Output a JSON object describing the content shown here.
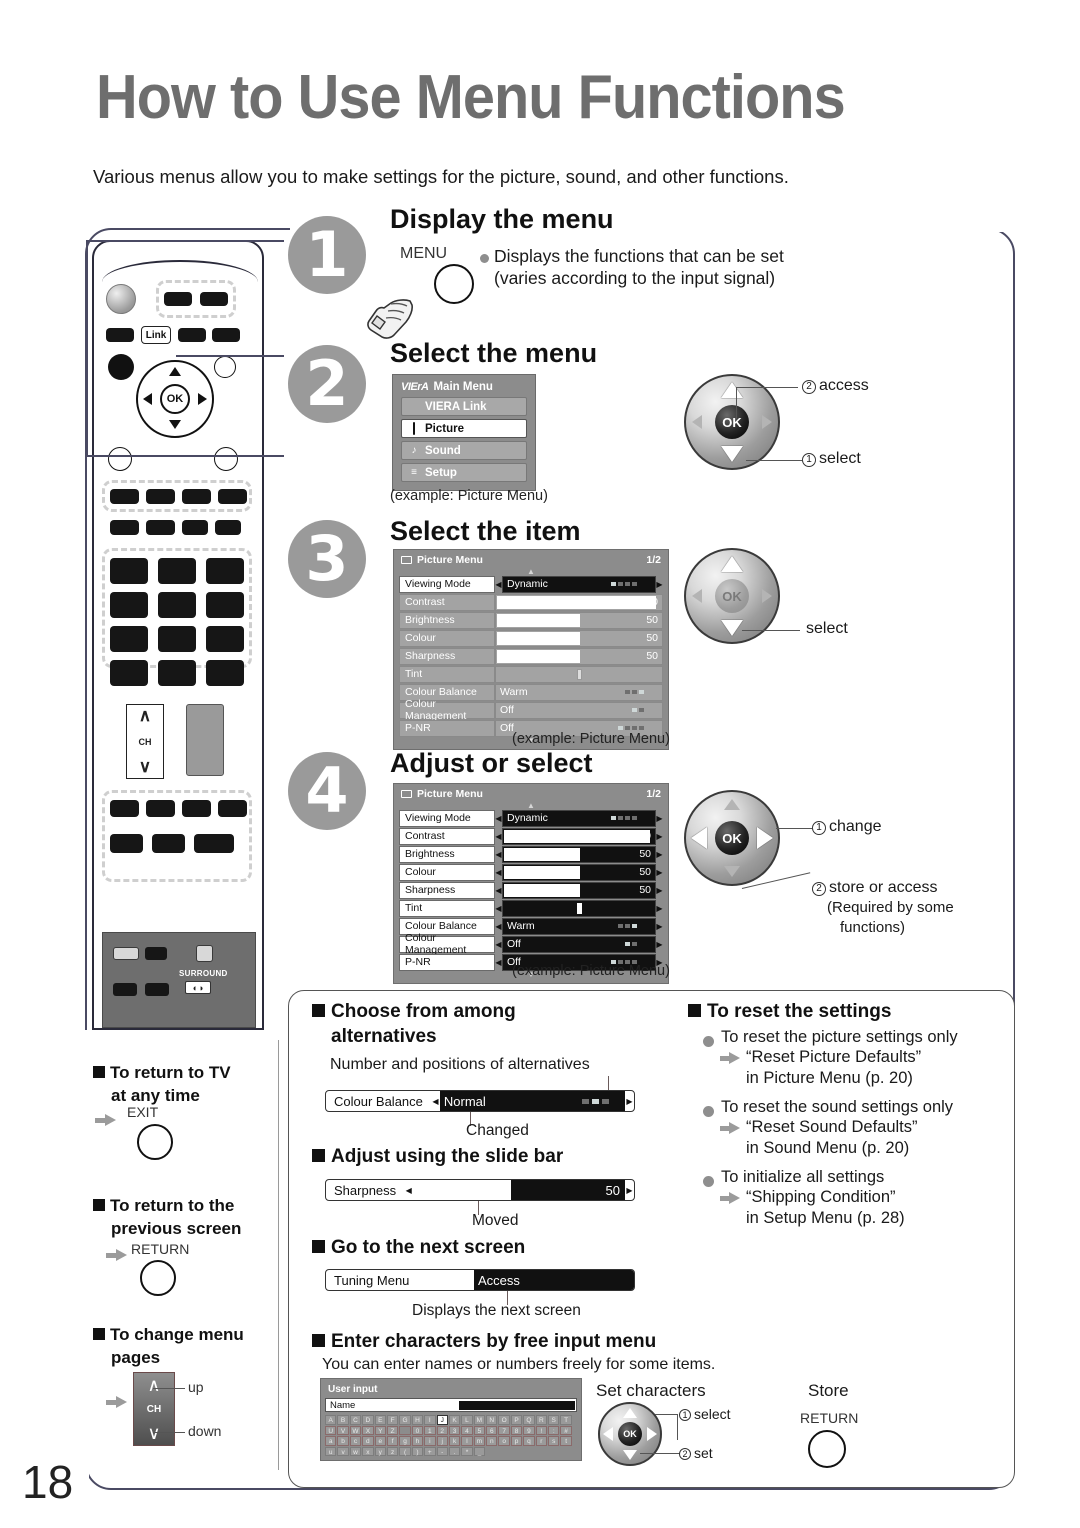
{
  "page": {
    "title": "How to Use Menu Functions",
    "intro": "Various menus allow you to make settings for the picture, sound, and other functions.",
    "number": "18"
  },
  "steps": [
    {
      "num": "1",
      "heading": "Display the menu",
      "key_label": "MENU",
      "desc_line1": "Displays the functions that can be set",
      "desc_line2": "(varies according to the input signal)"
    },
    {
      "num": "2",
      "heading": "Select the menu",
      "caption": "(example: Picture Menu)",
      "wheel_labels": [
        {
          "index": "2",
          "text": "access"
        },
        {
          "index": "1",
          "text": "select"
        }
      ]
    },
    {
      "num": "3",
      "heading": "Select the item",
      "caption": "(example: Picture Menu)",
      "wheel_labels": [
        {
          "index": "",
          "text": "select"
        }
      ]
    },
    {
      "num": "4",
      "heading": "Adjust or select",
      "caption": "(example: Picture Menu)",
      "wheel_labels": [
        {
          "index": "1",
          "text": "change"
        },
        {
          "index": "2",
          "text": "store or access"
        }
      ],
      "wheel_sub_line1": "(Required by some",
      "wheel_sub_line2": "functions)"
    }
  ],
  "main_menu": {
    "logo": "VIErA",
    "title": "Main Menu",
    "items": [
      {
        "label": "VIERA Link",
        "icon": "none",
        "selected": false
      },
      {
        "label": "Picture",
        "icon": "picture-icon",
        "selected": true
      },
      {
        "label": "Sound",
        "icon": "music-note-icon",
        "selected": false
      },
      {
        "label": "Setup",
        "icon": "list-icon",
        "selected": false
      }
    ]
  },
  "picture_menu": {
    "title": "Picture Menu",
    "page_indicator": "1/2",
    "rows": [
      {
        "label": "Viewing Mode",
        "value": "Dynamic",
        "type": "options",
        "dots": 4,
        "dot_on": 0,
        "selected": true
      },
      {
        "label": "Contrast",
        "value": "100",
        "type": "slider",
        "fill": 96,
        "selected": false
      },
      {
        "label": "Brightness",
        "value": "50",
        "type": "slider",
        "fill": 50,
        "selected": false
      },
      {
        "label": "Colour",
        "value": "50",
        "type": "slider",
        "fill": 50,
        "selected": false
      },
      {
        "label": "Sharpness",
        "value": "50",
        "type": "slider",
        "fill": 50,
        "selected": false
      },
      {
        "label": "Tint",
        "value": "",
        "type": "knob",
        "fill": 50,
        "selected": false
      },
      {
        "label": "Colour Balance",
        "value": "Warm",
        "type": "options",
        "dots": 3,
        "dot_on": 2,
        "selected": false
      },
      {
        "label": "Colour Management",
        "value": "Off",
        "type": "options",
        "dots": 2,
        "dot_on": 0,
        "selected": false
      },
      {
        "label": "P-NR",
        "value": "Off",
        "type": "options",
        "dots": 4,
        "dot_on": 0,
        "selected": false
      }
    ]
  },
  "picture_menu_active": {
    "title": "Picture Menu",
    "page_indicator": "1/2",
    "rows": [
      {
        "label": "Viewing Mode",
        "value": "Dynamic",
        "type": "options",
        "dots": 4,
        "dot_on": 0,
        "selected": true
      },
      {
        "label": "Contrast",
        "value": "100",
        "type": "slider",
        "fill": 96,
        "selected": true
      },
      {
        "label": "Brightness",
        "value": "50",
        "type": "slider",
        "fill": 50,
        "selected": true
      },
      {
        "label": "Colour",
        "value": "50",
        "type": "slider",
        "fill": 50,
        "selected": true
      },
      {
        "label": "Sharpness",
        "value": "50",
        "type": "slider",
        "fill": 50,
        "selected": true
      },
      {
        "label": "Tint",
        "value": "",
        "type": "knob",
        "fill": 50,
        "selected": true
      },
      {
        "label": "Colour Balance",
        "value": "Warm",
        "type": "options",
        "dots": 3,
        "dot_on": 2,
        "selected": true
      },
      {
        "label": "Colour Management",
        "value": "Off",
        "type": "options",
        "dots": 2,
        "dot_on": 0,
        "selected": true
      },
      {
        "label": "P-NR",
        "value": "Off",
        "type": "options",
        "dots": 4,
        "dot_on": 0,
        "selected": true
      }
    ]
  },
  "left_notes": [
    {
      "heading_line1": "To return to TV",
      "heading_line2": "at any time",
      "key_label": "EXIT"
    },
    {
      "heading_line1": "To return to the",
      "heading_line2": "previous screen",
      "key_label": "RETURN"
    },
    {
      "heading_line1": "To change menu",
      "heading_line2": "pages",
      "key_label": "CH",
      "up_label": "up",
      "down_label": "down"
    }
  ],
  "bottom": {
    "choose": {
      "heading_line1": "Choose from among",
      "heading_line2": "alternatives",
      "note_top": "Number and positions of alternatives",
      "note_bottom": "Changed",
      "row": {
        "label": "Colour Balance",
        "value": "Normal",
        "dots": 3,
        "dot_on": 1
      }
    },
    "slide": {
      "heading": "Adjust using the slide bar",
      "note_bottom": "Moved",
      "row": {
        "label": "Sharpness",
        "value": "50",
        "fill": 46
      }
    },
    "next_screen": {
      "heading": "Go to the next screen",
      "note_bottom": "Displays the next screen",
      "row": {
        "label": "Tuning Menu",
        "value": "Access"
      }
    },
    "free_input": {
      "heading": "Enter characters by free input menu",
      "sub": "You can enter names or numbers freely for some items.",
      "set_characters_label": "Set characters",
      "store_label": "Store",
      "store_key": "RETURN",
      "wheel_labels": [
        {
          "index": "1",
          "text": "select"
        },
        {
          "index": "2",
          "text": "set"
        }
      ],
      "panel": {
        "title": "User input",
        "name_label": "Name",
        "keyboard_rows": [
          [
            "A",
            "B",
            "C",
            "D",
            "E",
            "F",
            "G",
            "H",
            "I",
            "J",
            "K",
            "L",
            "M",
            "N",
            "O",
            "P",
            "Q",
            "R",
            "S",
            "T"
          ],
          [
            "U",
            "V",
            "W",
            "X",
            "Y",
            "Z",
            "",
            "0",
            "1",
            "2",
            "3",
            "4",
            "5",
            "6",
            "7",
            "8",
            "9",
            "!",
            ":",
            "#"
          ],
          [
            "a",
            "b",
            "c",
            "d",
            "e",
            "f",
            "g",
            "h",
            "i",
            "j",
            "k",
            "l",
            "m",
            "n",
            "o",
            "p",
            "q",
            "r",
            "s",
            "t"
          ],
          [
            "u",
            "v",
            "w",
            "x",
            "y",
            "z",
            "(",
            ")",
            "+",
            "-",
            ".",
            "*",
            "_",
            "",
            "",
            "",
            "",
            "",
            "",
            ""
          ]
        ],
        "selected_key": "J"
      }
    },
    "reset": {
      "heading": "To reset the settings",
      "items": [
        {
          "bullet": "To reset the picture settings only",
          "arrow_line1": "“Reset Picture Defaults”",
          "arrow_line2": "in Picture Menu (p. 20)"
        },
        {
          "bullet": "To reset the sound settings only",
          "arrow_line1": "“Reset Sound Defaults”",
          "arrow_line2": "in Sound Menu (p. 20)"
        },
        {
          "bullet": "To initialize all settings",
          "arrow_line1": "“Shipping Condition”",
          "arrow_line2": "in Setup Menu (p. 28)"
        }
      ]
    }
  },
  "remote": {
    "link_key": "Link",
    "ch_label": "CH",
    "surround_label": "SURROUND"
  }
}
